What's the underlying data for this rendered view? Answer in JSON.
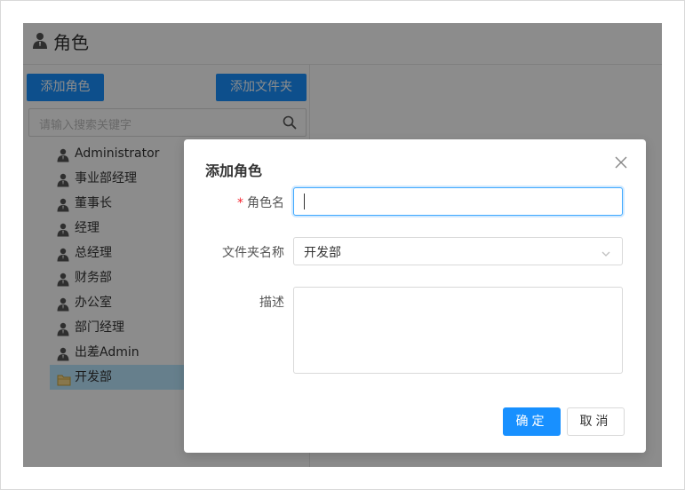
{
  "header": {
    "title": "角色"
  },
  "toolbar": {
    "add_role_label": "添加角色",
    "add_folder_label": "添加文件夹"
  },
  "search": {
    "placeholder": "请输入搜索关键字"
  },
  "tree": {
    "items": [
      {
        "label": "Administrator",
        "icon": "user-icon"
      },
      {
        "label": "事业部经理",
        "icon": "user-icon"
      },
      {
        "label": "董事长",
        "icon": "user-icon"
      },
      {
        "label": "经理",
        "icon": "user-icon"
      },
      {
        "label": "总经理",
        "icon": "user-icon"
      },
      {
        "label": "财务部",
        "icon": "user-icon"
      },
      {
        "label": "办公室",
        "icon": "user-icon"
      },
      {
        "label": "部门经理",
        "icon": "user-icon"
      },
      {
        "label": "出差Admin",
        "icon": "user-icon"
      },
      {
        "label": "开发部",
        "icon": "folder-icon",
        "selected": true
      }
    ]
  },
  "modal": {
    "title": "添加角色",
    "role_name_label": "角色名",
    "role_name_value": "",
    "folder_label": "文件夹名称",
    "folder_value": "开发部",
    "description_label": "描述",
    "description_value": "",
    "ok_label": "确定",
    "cancel_label": "取消"
  },
  "colors": {
    "accent": "#1890ff",
    "required": "#f5222d",
    "overlay": "rgba(0,0,0,0.45)"
  }
}
